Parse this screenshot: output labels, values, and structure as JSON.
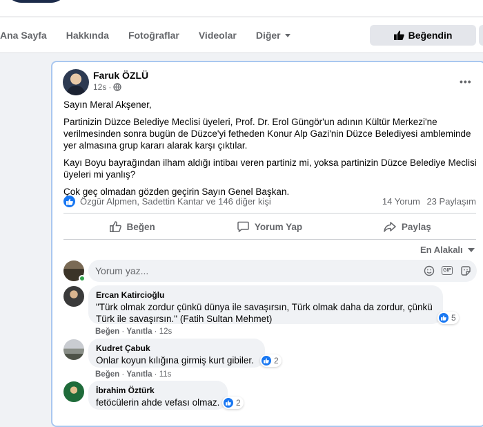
{
  "nav": {
    "tabs": [
      "Ana Sayfa",
      "Hakkında",
      "Fotoğraflar",
      "Videolar",
      "Diğer"
    ],
    "like_page": "Beğendin"
  },
  "post": {
    "author": "Faruk ÖZLÜ",
    "time": "12s",
    "paragraphs": [
      "Sayın Meral Akşener,",
      "Partinizin Düzce Belediye Meclisi üyeleri, Prof. Dr. Erol Güngör'un adının Kültür Merkezi'ne verilmesinden sonra bugün de Düzce'yi fetheden Konur Alp Gazi'nin Düzce Belediyesi ambleminde yer almasına grup kararı alarak karşı çıktılar.",
      "Kayı Boyu bayrağından ilham aldığı intibaı veren partiniz mi, yoksa partinizin Düzce Belediye Meclisi üyeleri mi yanlış?",
      "Çok geç olmadan gözden geçirin Sayın Genel Başkan."
    ],
    "reactions_text": "Özgür Alpmen, Sadettin Kantar ve 146 diğer kişi",
    "comments_count": "14 Yorum",
    "shares_count": "23 Paylaşım",
    "actions": {
      "like": "Beğen",
      "comment": "Yorum Yap",
      "share": "Paylaş"
    },
    "sort_label": "En Alakalı",
    "composer_placeholder": "Yorum yaz..."
  },
  "comments": [
    {
      "name": "Ercan Katircioğlu",
      "text": "\"Türk olmak zordur çünkü dünya ile savaşırsın, Türk olmak daha da zordur, çünkü Türk ile savaşırsın.\" (Fatih Sultan Mehmet)",
      "reactions": "5",
      "like": "Beğen",
      "reply": "Yanıtla",
      "time": "12s"
    },
    {
      "name": "Kudret Çabuk",
      "text": "Onlar koyun kılığına girmiş kurt gibiler.",
      "reactions": "2",
      "like": "Beğen",
      "reply": "Yanıtla",
      "time": "11s"
    },
    {
      "name": "İbrahim Öztürk",
      "text": "fetöcülerin ahde vefası olmaz.",
      "reactions": "2"
    }
  ],
  "colors": {
    "accent": "#1877f2",
    "muted": "#65676b",
    "bubble": "#f0f2f5"
  },
  "icons": [
    "like-thumb-icon",
    "globe-icon",
    "more-icon",
    "comment-icon",
    "share-icon",
    "emoji-icon",
    "gif-icon",
    "sticker-icon"
  ]
}
